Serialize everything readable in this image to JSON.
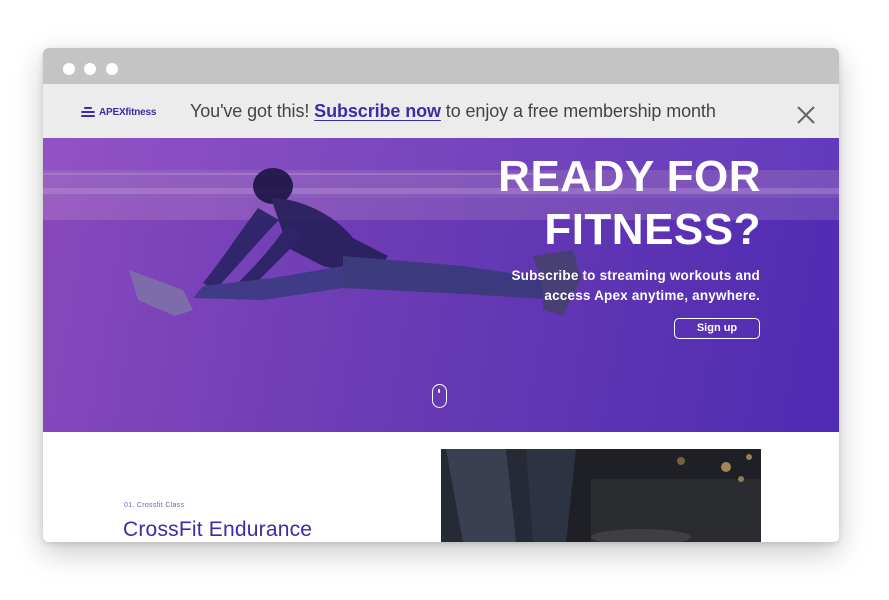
{
  "window": {
    "traffic_lights": [
      "close",
      "minimize",
      "maximize"
    ]
  },
  "promo_bar": {
    "logo_text": "APEXfitness",
    "lead_text": "You've got this! ",
    "link_text": "Subscribe now",
    "trail_text": " to enjoy a free membership month",
    "close_icon": "close-icon"
  },
  "hero": {
    "title_line1": "READY FOR",
    "title_line2": "FITNESS?",
    "subtitle_line1": "Subscribe to streaming workouts and",
    "subtitle_line2": "access Apex anytime, anywhere.",
    "cta_label": "Sign up",
    "scroll_icon": "mouse-scroll-icon"
  },
  "section": {
    "eyebrow": "01. Crossfit Class",
    "title": "CrossFit Endurance"
  },
  "colors": {
    "brand": "#3a2ea5",
    "hero_overlay_start": "#a854d2",
    "hero_overlay_end": "#4824be",
    "promo_bg": "#ececec",
    "titlebar_bg": "#c4c4c4"
  }
}
